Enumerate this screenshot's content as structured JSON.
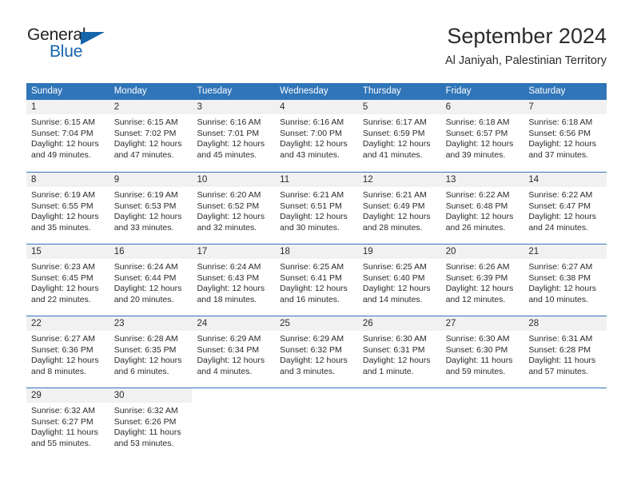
{
  "brand": {
    "name_part1": "General",
    "name_part2": "Blue",
    "color_dark": "#231f20",
    "color_blue": "#1464aa"
  },
  "header": {
    "title": "September 2024",
    "subtitle": "Al Janiyah, Palestinian Territory",
    "accent_color": "#3075b8",
    "daynum_strip_color": "#f1f1f1"
  },
  "weekdays": [
    "Sunday",
    "Monday",
    "Tuesday",
    "Wednesday",
    "Thursday",
    "Friday",
    "Saturday"
  ],
  "labels": {
    "sunrise": "Sunrise:",
    "sunset": "Sunset:",
    "daylight": "Daylight:"
  },
  "weeks": [
    [
      {
        "day": "1",
        "sunrise": "Sunrise: 6:15 AM",
        "sunset": "Sunset: 7:04 PM",
        "daylight1": "Daylight: 12 hours",
        "daylight2": "and 49 minutes."
      },
      {
        "day": "2",
        "sunrise": "Sunrise: 6:15 AM",
        "sunset": "Sunset: 7:02 PM",
        "daylight1": "Daylight: 12 hours",
        "daylight2": "and 47 minutes."
      },
      {
        "day": "3",
        "sunrise": "Sunrise: 6:16 AM",
        "sunset": "Sunset: 7:01 PM",
        "daylight1": "Daylight: 12 hours",
        "daylight2": "and 45 minutes."
      },
      {
        "day": "4",
        "sunrise": "Sunrise: 6:16 AM",
        "sunset": "Sunset: 7:00 PM",
        "daylight1": "Daylight: 12 hours",
        "daylight2": "and 43 minutes."
      },
      {
        "day": "5",
        "sunrise": "Sunrise: 6:17 AM",
        "sunset": "Sunset: 6:59 PM",
        "daylight1": "Daylight: 12 hours",
        "daylight2": "and 41 minutes."
      },
      {
        "day": "6",
        "sunrise": "Sunrise: 6:18 AM",
        "sunset": "Sunset: 6:57 PM",
        "daylight1": "Daylight: 12 hours",
        "daylight2": "and 39 minutes."
      },
      {
        "day": "7",
        "sunrise": "Sunrise: 6:18 AM",
        "sunset": "Sunset: 6:56 PM",
        "daylight1": "Daylight: 12 hours",
        "daylight2": "and 37 minutes."
      }
    ],
    [
      {
        "day": "8",
        "sunrise": "Sunrise: 6:19 AM",
        "sunset": "Sunset: 6:55 PM",
        "daylight1": "Daylight: 12 hours",
        "daylight2": "and 35 minutes."
      },
      {
        "day": "9",
        "sunrise": "Sunrise: 6:19 AM",
        "sunset": "Sunset: 6:53 PM",
        "daylight1": "Daylight: 12 hours",
        "daylight2": "and 33 minutes."
      },
      {
        "day": "10",
        "sunrise": "Sunrise: 6:20 AM",
        "sunset": "Sunset: 6:52 PM",
        "daylight1": "Daylight: 12 hours",
        "daylight2": "and 32 minutes."
      },
      {
        "day": "11",
        "sunrise": "Sunrise: 6:21 AM",
        "sunset": "Sunset: 6:51 PM",
        "daylight1": "Daylight: 12 hours",
        "daylight2": "and 30 minutes."
      },
      {
        "day": "12",
        "sunrise": "Sunrise: 6:21 AM",
        "sunset": "Sunset: 6:49 PM",
        "daylight1": "Daylight: 12 hours",
        "daylight2": "and 28 minutes."
      },
      {
        "day": "13",
        "sunrise": "Sunrise: 6:22 AM",
        "sunset": "Sunset: 6:48 PM",
        "daylight1": "Daylight: 12 hours",
        "daylight2": "and 26 minutes."
      },
      {
        "day": "14",
        "sunrise": "Sunrise: 6:22 AM",
        "sunset": "Sunset: 6:47 PM",
        "daylight1": "Daylight: 12 hours",
        "daylight2": "and 24 minutes."
      }
    ],
    [
      {
        "day": "15",
        "sunrise": "Sunrise: 6:23 AM",
        "sunset": "Sunset: 6:45 PM",
        "daylight1": "Daylight: 12 hours",
        "daylight2": "and 22 minutes."
      },
      {
        "day": "16",
        "sunrise": "Sunrise: 6:24 AM",
        "sunset": "Sunset: 6:44 PM",
        "daylight1": "Daylight: 12 hours",
        "daylight2": "and 20 minutes."
      },
      {
        "day": "17",
        "sunrise": "Sunrise: 6:24 AM",
        "sunset": "Sunset: 6:43 PM",
        "daylight1": "Daylight: 12 hours",
        "daylight2": "and 18 minutes."
      },
      {
        "day": "18",
        "sunrise": "Sunrise: 6:25 AM",
        "sunset": "Sunset: 6:41 PM",
        "daylight1": "Daylight: 12 hours",
        "daylight2": "and 16 minutes."
      },
      {
        "day": "19",
        "sunrise": "Sunrise: 6:25 AM",
        "sunset": "Sunset: 6:40 PM",
        "daylight1": "Daylight: 12 hours",
        "daylight2": "and 14 minutes."
      },
      {
        "day": "20",
        "sunrise": "Sunrise: 6:26 AM",
        "sunset": "Sunset: 6:39 PM",
        "daylight1": "Daylight: 12 hours",
        "daylight2": "and 12 minutes."
      },
      {
        "day": "21",
        "sunrise": "Sunrise: 6:27 AM",
        "sunset": "Sunset: 6:38 PM",
        "daylight1": "Daylight: 12 hours",
        "daylight2": "and 10 minutes."
      }
    ],
    [
      {
        "day": "22",
        "sunrise": "Sunrise: 6:27 AM",
        "sunset": "Sunset: 6:36 PM",
        "daylight1": "Daylight: 12 hours",
        "daylight2": "and 8 minutes."
      },
      {
        "day": "23",
        "sunrise": "Sunrise: 6:28 AM",
        "sunset": "Sunset: 6:35 PM",
        "daylight1": "Daylight: 12 hours",
        "daylight2": "and 6 minutes."
      },
      {
        "day": "24",
        "sunrise": "Sunrise: 6:29 AM",
        "sunset": "Sunset: 6:34 PM",
        "daylight1": "Daylight: 12 hours",
        "daylight2": "and 4 minutes."
      },
      {
        "day": "25",
        "sunrise": "Sunrise: 6:29 AM",
        "sunset": "Sunset: 6:32 PM",
        "daylight1": "Daylight: 12 hours",
        "daylight2": "and 3 minutes."
      },
      {
        "day": "26",
        "sunrise": "Sunrise: 6:30 AM",
        "sunset": "Sunset: 6:31 PM",
        "daylight1": "Daylight: 12 hours",
        "daylight2": "and 1 minute."
      },
      {
        "day": "27",
        "sunrise": "Sunrise: 6:30 AM",
        "sunset": "Sunset: 6:30 PM",
        "daylight1": "Daylight: 11 hours",
        "daylight2": "and 59 minutes."
      },
      {
        "day": "28",
        "sunrise": "Sunrise: 6:31 AM",
        "sunset": "Sunset: 6:28 PM",
        "daylight1": "Daylight: 11 hours",
        "daylight2": "and 57 minutes."
      }
    ],
    [
      {
        "day": "29",
        "sunrise": "Sunrise: 6:32 AM",
        "sunset": "Sunset: 6:27 PM",
        "daylight1": "Daylight: 11 hours",
        "daylight2": "and 55 minutes."
      },
      {
        "day": "30",
        "sunrise": "Sunrise: 6:32 AM",
        "sunset": "Sunset: 6:26 PM",
        "daylight1": "Daylight: 11 hours",
        "daylight2": "and 53 minutes."
      },
      {
        "day": "",
        "sunrise": "",
        "sunset": "",
        "daylight1": "",
        "daylight2": ""
      },
      {
        "day": "",
        "sunrise": "",
        "sunset": "",
        "daylight1": "",
        "daylight2": ""
      },
      {
        "day": "",
        "sunrise": "",
        "sunset": "",
        "daylight1": "",
        "daylight2": ""
      },
      {
        "day": "",
        "sunrise": "",
        "sunset": "",
        "daylight1": "",
        "daylight2": ""
      },
      {
        "day": "",
        "sunrise": "",
        "sunset": "",
        "daylight1": "",
        "daylight2": ""
      }
    ]
  ]
}
